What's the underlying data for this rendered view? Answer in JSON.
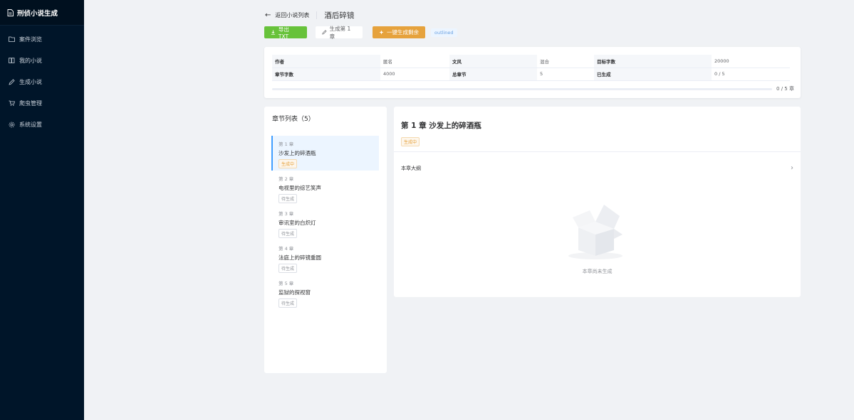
{
  "app": {
    "title": "刑侦小说生成"
  },
  "sidebar": {
    "items": [
      {
        "label": "案件浏览",
        "icon": "folder-icon"
      },
      {
        "label": "我的小说",
        "icon": "book-icon"
      },
      {
        "label": "生成小说",
        "icon": "edit-icon"
      },
      {
        "label": "爬虫管理",
        "icon": "cart-icon"
      },
      {
        "label": "系统设置",
        "icon": "gear-icon"
      }
    ]
  },
  "header": {
    "back_label": "返回小说列表",
    "title": "酒后碎镜"
  },
  "toolbar": {
    "export_label": "导出 TXT",
    "generate_chapter_label": "生成第 1 章",
    "generate_all_label": "一键生成剩余",
    "status_tag": "outlined"
  },
  "info": {
    "rows": [
      [
        {
          "k": "作者",
          "v": "匿名"
        },
        {
          "k": "文风",
          "v": "混合"
        },
        {
          "k": "目标字数",
          "v": "20000"
        }
      ],
      [
        {
          "k": "章节字数",
          "v": "4000"
        },
        {
          "k": "总章节",
          "v": "5"
        },
        {
          "k": "已生成",
          "v": "0 / 5"
        }
      ]
    ],
    "progress_text": "0 / 5 章",
    "progress_fraction": 0
  },
  "chapters": {
    "title": "章节列表（5）",
    "items": [
      {
        "num": "第 1 章",
        "title": "沙发上的碎酒瓶",
        "status": "生成中",
        "active": true
      },
      {
        "num": "第 2 章",
        "title": "电视里的综艺笑声",
        "status": "待生成",
        "active": false
      },
      {
        "num": "第 3 章",
        "title": "审讯室的白炽灯",
        "status": "待生成",
        "active": false
      },
      {
        "num": "第 4 章",
        "title": "法庭上的碎镜重圆",
        "status": "待生成",
        "active": false
      },
      {
        "num": "第 5 章",
        "title": "监狱的探视窗",
        "status": "待生成",
        "active": false
      }
    ]
  },
  "detail": {
    "title": "第 1 章 沙发上的碎酒瓶",
    "status": "生成中",
    "outline_label": "本章大纲",
    "empty_text": "本章尚未生成"
  },
  "colors": {
    "sidebar_bg": "#001529",
    "primary": "#409eff",
    "success": "#67c23a",
    "warning": "#e6a23c"
  }
}
